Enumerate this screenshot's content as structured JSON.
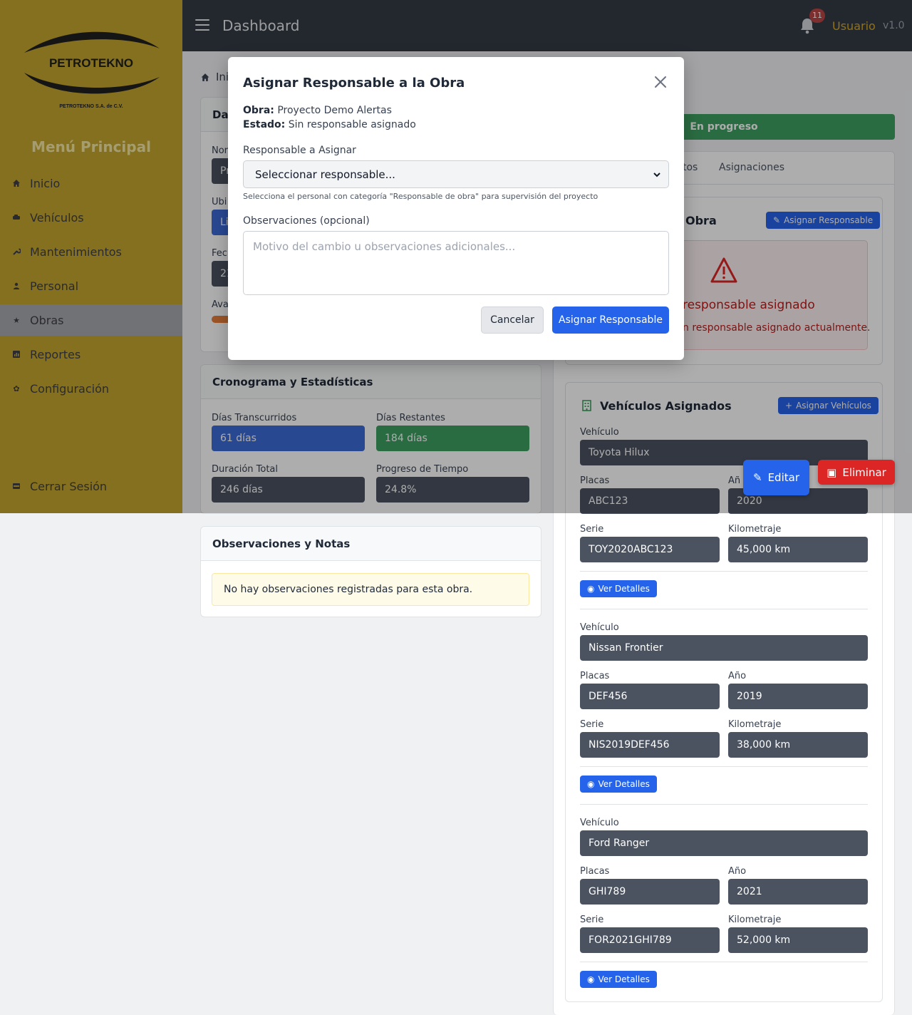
{
  "sidebar": {
    "brand": "PETROTEKNO",
    "brand_sub": "PETROTEKNO S.A. de C.V.",
    "menu_title": "Menú Principal",
    "items": [
      {
        "label": "Inicio",
        "icon": "home-icon"
      },
      {
        "label": "Vehículos",
        "icon": "car-icon"
      },
      {
        "label": "Mantenimientos",
        "icon": "wrench-icon"
      },
      {
        "label": "Personal",
        "icon": "user-icon"
      },
      {
        "label": "Obras",
        "icon": "star-icon",
        "active": true
      },
      {
        "label": "Reportes",
        "icon": "chart-icon"
      },
      {
        "label": "Configuración",
        "icon": "gear-icon"
      }
    ],
    "logout": "Cerrar Sesión"
  },
  "topbar": {
    "title": "Dashboard",
    "notifications": "11",
    "user": "Usuario",
    "version": "v1.0"
  },
  "breadcrumb": "Ini",
  "datos": {
    "header": "Dat",
    "nombre_label": "Nor",
    "nombre_value": "Pr",
    "ubic_label": "Ubi",
    "ubic_value": "Li",
    "fecha_label": "Fec",
    "fecha_value": "21",
    "avance_label": "Ava"
  },
  "status": "En progreso",
  "tabs": {
    "partial": "tos",
    "asignaciones": "Asignaciones"
  },
  "responsable": {
    "header_tail": "Obra",
    "assign_btn": "Asignar Responsable",
    "empty_title": "responsable asignado",
    "empty_text": "n responsable asignado actualmente."
  },
  "cronograma": {
    "header": "Cronograma y Estadísticas",
    "dias_trans_label": "Días Transcurridos",
    "dias_trans": "61 días",
    "dias_rest_label": "Días Restantes",
    "dias_rest": "184 días",
    "duracion_label": "Duración Total",
    "duracion": "246 días",
    "progreso_label": "Progreso de Tiempo",
    "progreso": "24.8%"
  },
  "observaciones": {
    "header": "Observaciones y Notas",
    "empty": "No hay observaciones registradas para esta obra."
  },
  "vehiculos": {
    "header": "Vehículos Asignados",
    "assign_btn": "Asignar Vehículos",
    "labels": {
      "vehiculo": "Vehículo",
      "placas": "Placas",
      "anio": "Año",
      "serie": "Serie",
      "km": "Kilometraje",
      "ver": "Ver Detalles"
    },
    "anio_partial": "Añ",
    "items": [
      {
        "vehiculo": "Toyota Hilux",
        "placas": "ABC123",
        "anio": "2020",
        "serie": "TOY2020ABC123",
        "km": "45,000 km"
      },
      {
        "vehiculo": "Nissan Frontier",
        "placas": "DEF456",
        "anio": "2019",
        "serie": "NIS2019DEF456",
        "km": "38,000 km"
      },
      {
        "vehiculo": "Ford Ranger",
        "placas": "GHI789",
        "anio": "2021",
        "serie": "FOR2021GHI789",
        "km": "52,000 km"
      }
    ]
  },
  "fabs": {
    "edit": "Editar",
    "delete": "Eliminar"
  },
  "modal": {
    "title": "Asignar Responsable a la Obra",
    "obra_label": "Obra:",
    "obra_value": "Proyecto Demo Alertas",
    "estado_label": "Estado:",
    "estado_value": "Sin responsable asignado",
    "select_label": "Responsable a Asignar",
    "select_value": "Seleccionar responsable...",
    "hint": "Selecciona el personal con categoría \"Responsable de obra\" para supervisión del proyecto",
    "obs_label": "Observaciones (opcional)",
    "obs_placeholder": "Motivo del cambio u observaciones adicionales...",
    "cancel": "Cancelar",
    "submit": "Asignar Responsable"
  },
  "colors": {
    "sidebar": "#c3a62d",
    "topbar": "#343a45",
    "primary": "#2563eb",
    "success": "#3ea060",
    "danger": "#dc2626"
  }
}
